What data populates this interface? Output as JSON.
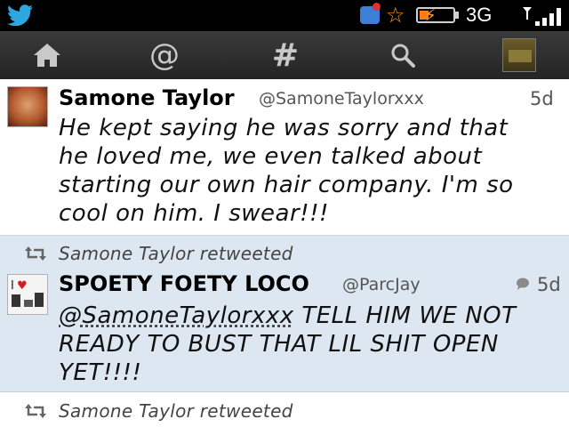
{
  "status_bar": {
    "network": "3G",
    "icons": [
      "twitter-bird-icon",
      "bbm-notification-icon",
      "star-icon",
      "battery-charging-icon",
      "signal-strength-icon"
    ],
    "colors": {
      "twitter": "#2ea7e0",
      "battery": "#ff7a1a",
      "star": "#ff9a1a"
    }
  },
  "nav": {
    "items": [
      {
        "icon": "home-icon"
      },
      {
        "icon": "at-mention-icon",
        "glyph": "@"
      },
      {
        "icon": "hashtag-icon",
        "glyph": "#"
      },
      {
        "icon": "search-icon"
      },
      {
        "icon": "profile-avatar-icon"
      }
    ]
  },
  "timeline": {
    "tweets": [
      {
        "name": "Samone Taylor",
        "handle": "@SamoneTaylorxxx",
        "time": "5d",
        "lines": [
          "He kept saying he was sorry and that",
          "he loved me, we even talked about",
          "starting our own hair company. I'm so",
          "cool on him. I swear!!!"
        ]
      },
      {
        "retweeted_by": "Samone Taylor  retweeted",
        "name": "SPOETY FOETY LOCO",
        "handle": "@ParcJay",
        "time": "5d",
        "mention": "@SamoneTaylorxxx",
        "lines": [
          " TELL HIM WE NOT",
          "READY TO BUST THAT LIL SHIT OPEN",
          "YET!!!!"
        ]
      },
      {
        "retweeted_by": "Samone Taylor  retweeted"
      }
    ]
  }
}
